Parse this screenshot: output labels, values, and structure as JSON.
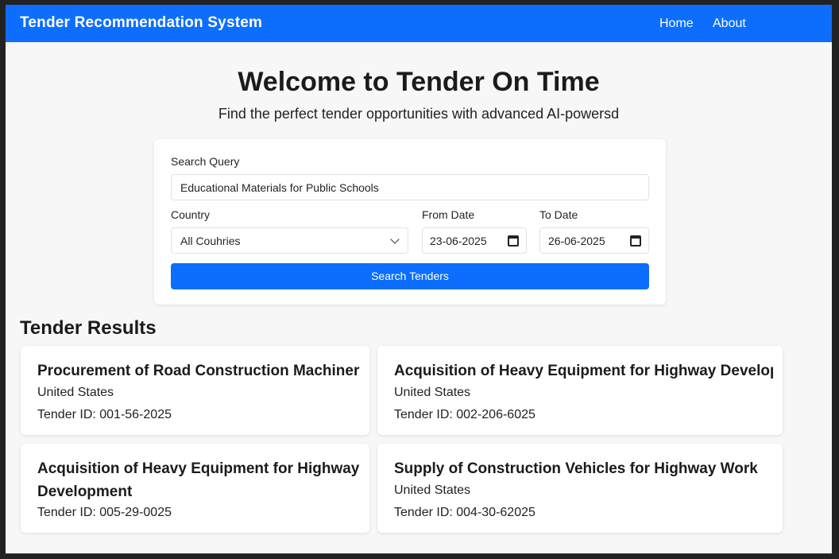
{
  "navbar": {
    "brand": "Tender Recommendation System",
    "links": [
      "Home",
      "About"
    ]
  },
  "hero": {
    "title": "Welcome to Tender On Time",
    "subtitle": "Find the perfect tender opportunities with advanced AI-powersd"
  },
  "search": {
    "query_label": "Search Query",
    "query_value": "Educational Materials for Public Schools",
    "country_label": "Country",
    "country_value": "All Couhries",
    "from_label": "From Date",
    "from_value": "23-06-2025",
    "to_label": "To Date",
    "to_value": "26-06-2025",
    "button_label": "Search Tenders"
  },
  "results": {
    "title": "Tender Results",
    "items": [
      {
        "title": "Procurement of Road Construction Machinery",
        "country": "United States",
        "tender_id": "Tender ID: 001-56-2025"
      },
      {
        "title": "Acquisition of Heavy Equipment for Highway Developm",
        "country": "United States",
        "tender_id": "Tender ID: 002-206-6025"
      },
      {
        "title": "Acquisition of Heavy Equipment for Highway Development",
        "country": "",
        "tender_id": "Tender ID: 005-29-0025"
      },
      {
        "title": "Supply of Construction Vehicles for Highway Work",
        "country": "United States",
        "tender_id": "Tender ID: 004-30-62025"
      }
    ]
  },
  "colors": {
    "primary": "#0d6efd",
    "page_bg": "#f7f7f8",
    "outer_border": "#222222"
  },
  "icons": {
    "date_picker": "calendar-icon",
    "select": "chevron-down-icon"
  }
}
